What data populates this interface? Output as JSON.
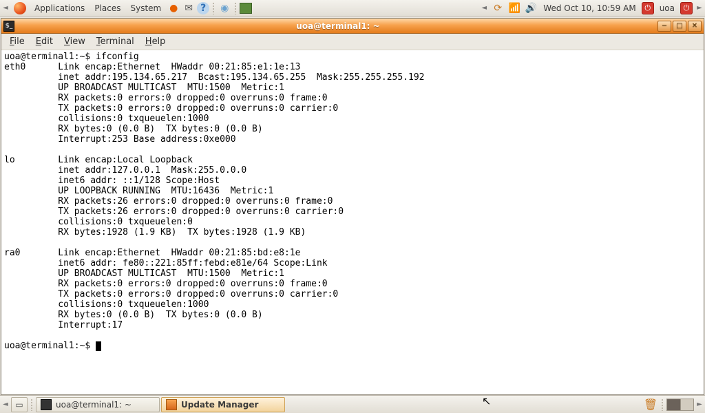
{
  "top_panel": {
    "menus": [
      "Applications",
      "Places",
      "System"
    ],
    "clock": "Wed Oct 10, 10:59 AM",
    "user": "uoa"
  },
  "window": {
    "title": "uoa@terminal1: ~",
    "menus": {
      "file": "File",
      "edit": "Edit",
      "view": "View",
      "terminal": "Terminal",
      "help": "Help"
    }
  },
  "terminal": {
    "prompt1": "uoa@terminal1:~$ ",
    "cmd1": "ifconfig",
    "output": "eth0      Link encap:Ethernet  HWaddr 00:21:85:e1:1e:13\n          inet addr:195.134.65.217  Bcast:195.134.65.255  Mask:255.255.255.192\n          UP BROADCAST MULTICAST  MTU:1500  Metric:1\n          RX packets:0 errors:0 dropped:0 overruns:0 frame:0\n          TX packets:0 errors:0 dropped:0 overruns:0 carrier:0\n          collisions:0 txqueuelen:1000\n          RX bytes:0 (0.0 B)  TX bytes:0 (0.0 B)\n          Interrupt:253 Base address:0xe000\n\nlo        Link encap:Local Loopback\n          inet addr:127.0.0.1  Mask:255.0.0.0\n          inet6 addr: ::1/128 Scope:Host\n          UP LOOPBACK RUNNING  MTU:16436  Metric:1\n          RX packets:26 errors:0 dropped:0 overruns:0 frame:0\n          TX packets:26 errors:0 dropped:0 overruns:0 carrier:0\n          collisions:0 txqueuelen:0\n          RX bytes:1928 (1.9 KB)  TX bytes:1928 (1.9 KB)\n\nra0       Link encap:Ethernet  HWaddr 00:21:85:bd:e8:1e\n          inet6 addr: fe80::221:85ff:febd:e81e/64 Scope:Link\n          UP BROADCAST MULTICAST  MTU:1500  Metric:1\n          RX packets:0 errors:0 dropped:0 overruns:0 frame:0\n          TX packets:0 errors:0 dropped:0 overruns:0 carrier:0\n          collisions:0 txqueuelen:1000\n          RX bytes:0 (0.0 B)  TX bytes:0 (0.0 B)\n          Interrupt:17\n",
    "prompt2": "uoa@terminal1:~$ "
  },
  "taskbar": {
    "items": [
      {
        "label": "uoa@terminal1: ~",
        "active": false
      },
      {
        "label": "Update Manager",
        "active": true
      }
    ]
  }
}
